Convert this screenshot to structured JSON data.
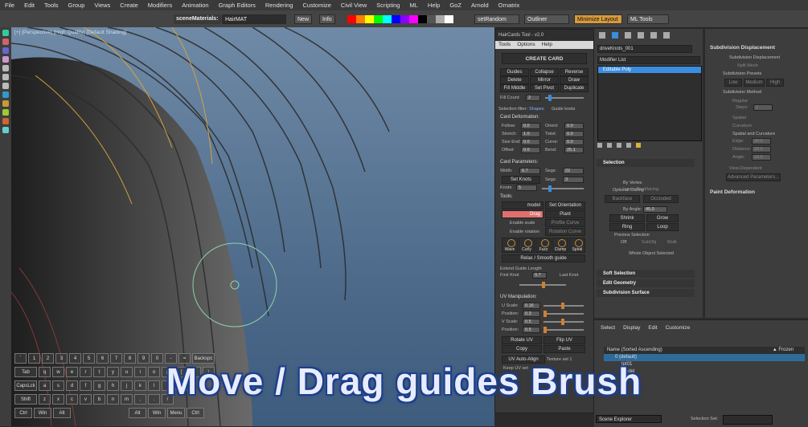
{
  "menu": [
    "File",
    "Edit",
    "Tools",
    "Group",
    "Views",
    "Create",
    "Modifiers",
    "Animation",
    "Graph Editors",
    "Rendering",
    "Customize",
    "Civil View",
    "Scripting",
    "ML",
    "Help",
    "GoZ",
    "Arnold",
    "Ornatrix"
  ],
  "toolbar": {
    "scene_materials_label": "sceneMaterials:",
    "material_value": "HairMAT",
    "new_btn": "New",
    "info_btn": "Info",
    "swatches": [
      "#ff0000",
      "#ff7f00",
      "#ffff00",
      "#00ff00",
      "#00ffff",
      "#0000ff",
      "#8b00ff",
      "#ff00ff",
      "#000000",
      "#555555",
      "#aaaaaa",
      "#ffffff"
    ],
    "set_random": "setRandom",
    "outliner": "Outliner",
    "minimize_layout": "Minimize Layout",
    "ml_tools": "ML Tools"
  },
  "viewport": {
    "label": "[+] [Perspective] [High Quality] [Default Shading]"
  },
  "haircards": {
    "title": "HairCards Tool - v2.0",
    "menu": [
      "Tools",
      "Options",
      "Help"
    ],
    "create_card": "CREATE CARD",
    "btns_row1": [
      "Guides",
      "Collapse",
      "Reverse"
    ],
    "btns_row2": [
      "Delete",
      "Mirror",
      "Draw"
    ],
    "btns_row3": [
      "Fill Middle",
      "Set Pivot",
      "Duplicate"
    ],
    "fill_count_label": "Fill Count:",
    "fill_count": "2",
    "selection_filter": "Selection filter:",
    "filter_shapes": "Shapes",
    "filter_guide": "Guide knots",
    "card_deformation": "Card Deformation:",
    "deform_left": [
      [
        "Follow:",
        "0.0"
      ],
      [
        "Stretch:",
        "1.0"
      ],
      [
        "Size End:",
        "0.0"
      ],
      [
        "Offset:",
        "0.0"
      ]
    ],
    "deform_right": [
      [
        "Orient:",
        "0.0"
      ],
      [
        "Twist:",
        "0.0"
      ],
      [
        "Curve:",
        "0.0"
      ],
      [
        "Bend:",
        "25.1"
      ]
    ],
    "card_parameters": "Card Parameters:",
    "width_label": "Width:",
    "width": "6.7",
    "segs_label": "Segs:",
    "segs": "22",
    "set_knots": "Set Knots",
    "segs2": "3",
    "knots_label": "Knots:",
    "knots": "5",
    "tools_label": "Tools:",
    "model": "model",
    "set_orientation": "Set Orientation",
    "drag": "Drag",
    "plant": "Plant",
    "enable_scale": "Enable scale",
    "profile_curve": "Profile Curve",
    "enable_rotation": "Enable rotation",
    "rotation_curve": "Rotation Curve",
    "brushes": [
      "Wave",
      "Curly",
      "Fuzz",
      "Clump",
      "Spiral"
    ],
    "relax": "Relax / Smooth guide",
    "extend_label": "Extend Guide Length",
    "first_knot": "First Knot",
    "last_knot": "Last Knot",
    "ext_value": "0.7",
    "uv_manip": "UV Manipulation:",
    "uv_fields": [
      [
        "U Scale:",
        "0.16"
      ],
      [
        "Position:",
        "0.3"
      ],
      [
        "V Scale:",
        "0.5"
      ],
      [
        "Position:",
        "0.5"
      ]
    ],
    "rotate_uv": "Rotate UV",
    "flip_uv": "Flip UV",
    "copy": "Copy",
    "paste": "Paste",
    "uv_auto_align": "UV Auto-Align",
    "texture_set": "Texture set 1",
    "keep_uv_set": "Keep UV set"
  },
  "command": {
    "object_name": "driveKnots_001",
    "modifier_list": "Modifier List",
    "stack_item": "Editable Poly",
    "selection": "Selection",
    "by_vertex": "By Vertex",
    "ignore_backfacing": "Ignore Backfacing",
    "optional_culling": "Optional Culling",
    "backface": "Backface",
    "occluded": "Occluded",
    "by_angle": "By Angle:",
    "angle_val": "45.0",
    "shrink": "Shrink",
    "grow": "Grow",
    "ring": "Ring",
    "loop": "Loop",
    "preview_selection": "Preview Selection",
    "off": "Off",
    "subobj": "SubObj",
    "multi": "Multi",
    "whole_object": "Whole Object Selected",
    "soft_selection": "Soft Selection",
    "edit_geometry": "Edit Geometry",
    "subdivision_surface": "Subdivision Surface"
  },
  "subdiv": {
    "title": "Subdivision Displacement",
    "check1": "Subdivision Displacement",
    "check2": "Split Mesh",
    "presets": "Subdivision Presets",
    "low": "Low",
    "medium": "Medium",
    "high": "High",
    "method": "Subdivision Method",
    "regular": "Regular",
    "steps_label": "Steps:",
    "steps": "2",
    "spatial": "Spatial",
    "curvature": "Curvature",
    "spatial_curv": "Spatial and Curvature",
    "edge_label": "Edge:",
    "edge": "20.0",
    "distance_label": "Distance:",
    "distance": "20.0",
    "angle_label": "Angle:",
    "angle": "10.0",
    "view_dependent": "View-Dependent",
    "advanced": "Advanced Parameters...",
    "paint_deformation": "Paint Deformation"
  },
  "scene": {
    "menu": [
      "Select",
      "Display",
      "Edit",
      "Customize"
    ],
    "col_name": "Name (Sorted Ascending)",
    "col_frozen": "▲ Frozen",
    "items": [
      "0 (default)",
      "tpt01",
      "model"
    ],
    "footer_label": "Scene Explorer",
    "selection_set": "Selection Set:"
  },
  "keyboard": {
    "row1": [
      "`",
      "1",
      "2",
      "3",
      "4",
      "5",
      "6",
      "7",
      "8",
      "9",
      "0",
      "-",
      "=",
      "Backspc"
    ],
    "row2": [
      "Tab",
      "q",
      "w",
      "e",
      "r",
      "t",
      "y",
      "u",
      "i",
      "o",
      "p",
      "[",
      "]",
      "\\"
    ],
    "row3": [
      "CapsLck",
      "a",
      "s",
      "d",
      "f",
      "g",
      "h",
      "j",
      "k",
      "l",
      ";",
      "'"
    ],
    "row4": [
      "Shift",
      "z",
      "x",
      "c",
      "v",
      "b",
      "n",
      "m",
      ",",
      ".",
      "/"
    ],
    "row5": [
      "Ctrl",
      "Win",
      "Alt",
      "Alt",
      "Win",
      "Menu",
      "Ctrl"
    ]
  },
  "caption": "Move / Drag guides Brush"
}
